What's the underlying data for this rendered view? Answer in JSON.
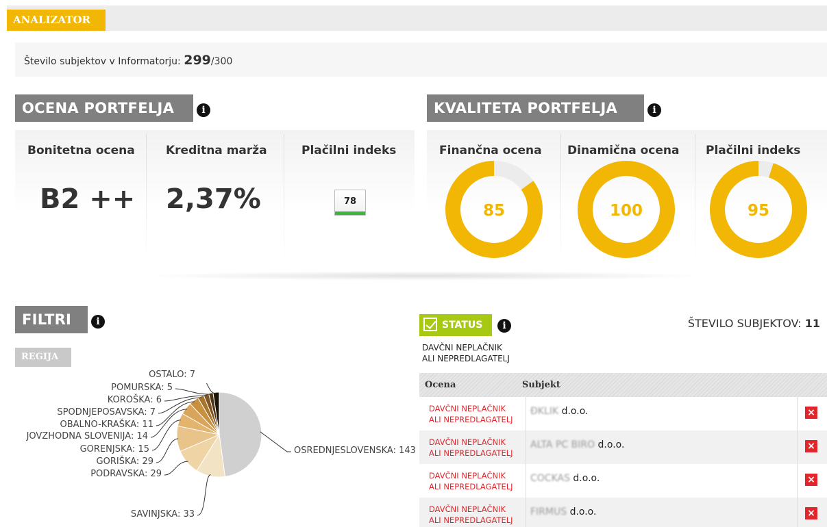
{
  "header": {
    "tab_label": "ANALIZATOR"
  },
  "counter": {
    "label": "Število subjektov v Informatorju:",
    "current": "299",
    "total": "/300"
  },
  "ocena_portfelja": {
    "title": "OCENA PORTFELJA",
    "columns": [
      {
        "label": "Bonitetna ocena",
        "value": "B2 ++"
      },
      {
        "label": "Kreditna marža",
        "value": "2,37%"
      },
      {
        "label": "Plačilni indeks",
        "value": "78"
      }
    ]
  },
  "kvaliteta_portfelja": {
    "title": "KVALITETA PORTFELJA",
    "gauges": [
      {
        "label": "Finančna ocena",
        "value": "85",
        "percent": 85
      },
      {
        "label": "Dinamična ocena",
        "value": "100",
        "percent": 100
      },
      {
        "label": "Plačilni indeks",
        "value": "95",
        "percent": 95
      }
    ],
    "colors": {
      "fill": "#f2b705",
      "track": "#ececec"
    }
  },
  "filtri": {
    "title": "FILTRI",
    "tab_label": "REGIJA",
    "chart_data": {
      "type": "pie",
      "slices": [
        {
          "name": "OSREDNJESLOVENSKA: 143",
          "region": "OSREDNJESLOVENSKA",
          "value": 143,
          "color": "#d0d0d0"
        },
        {
          "name": "SAVINJSKA: 33",
          "region": "SAVINJSKA",
          "value": 33,
          "color": "#f3e3c5"
        },
        {
          "name": "PODRAVSKA: 29",
          "region": "PODRAVSKA",
          "value": 29,
          "color": "#efd5a5"
        },
        {
          "name": "GORIŠKA: 29",
          "region": "GORIŠKA",
          "value": 29,
          "color": "#e8c48b"
        },
        {
          "name": "GORENJSKA: 15",
          "region": "GORENJSKA",
          "value": 15,
          "color": "#e2b46e"
        },
        {
          "name": "JOVZHODNA SLOVENIJA: 14",
          "region": "JOVZHODNA SLOVENIJA",
          "value": 14,
          "color": "#d9a55a"
        },
        {
          "name": "OBALNO-KRAŠKA: 11",
          "region": "OBALNO-KRAŠKA",
          "value": 11,
          "color": "#c9913f"
        },
        {
          "name": "SPODNJEPOSAVSKA: 7",
          "region": "SPODNJEPOSAVSKA",
          "value": 7,
          "color": "#a8752c"
        },
        {
          "name": "KOROŠKA: 6",
          "region": "KOROŠKA",
          "value": 6,
          "color": "#805520"
        },
        {
          "name": "POMURSKA: 5",
          "region": "POMURSKA",
          "value": 5,
          "color": "#4e3616"
        },
        {
          "name": "OSTALO: 7",
          "region": "OSTALO",
          "value": 7,
          "color": "#1c1409"
        }
      ]
    }
  },
  "status": {
    "badge_label": "STATUS",
    "description": [
      "DAVČNI NEPLAČNIK",
      "ALI NEPREDLAGATELJ"
    ],
    "count_label": "ŠTEVILO SUBJEKTOV:",
    "count_value": "11",
    "table": {
      "headers": [
        "Ocena",
        "Subjekt"
      ],
      "rows": [
        {
          "ocena": [
            "DAVČNI NEPLAČNIK",
            "ALI NEPREDLAGATELJ"
          ],
          "name_redacted": "ĐKLIK",
          "name_suffix": " d.o.o.",
          "remove": "×"
        },
        {
          "ocena": [
            "DAVČNI NEPLAČNIK",
            "ALI NEPREDLAGATELJ"
          ],
          "name_redacted": "ALTA PC BIRO",
          "name_suffix": " d.o.o.",
          "remove": "×"
        },
        {
          "ocena": [
            "DAVČNI NEPLAČNIK",
            "ALI NEPREDLAGATELJ"
          ],
          "name_redacted": "COCKAS",
          "name_suffix": " d.o.o.",
          "remove": "×"
        },
        {
          "ocena": [
            "DAVČNI NEPLAČNIK",
            "ALI NEPREDLAGATELJ"
          ],
          "name_redacted": "FIRMUS",
          "name_suffix": " d.o.o.",
          "remove": "×"
        }
      ]
    }
  }
}
